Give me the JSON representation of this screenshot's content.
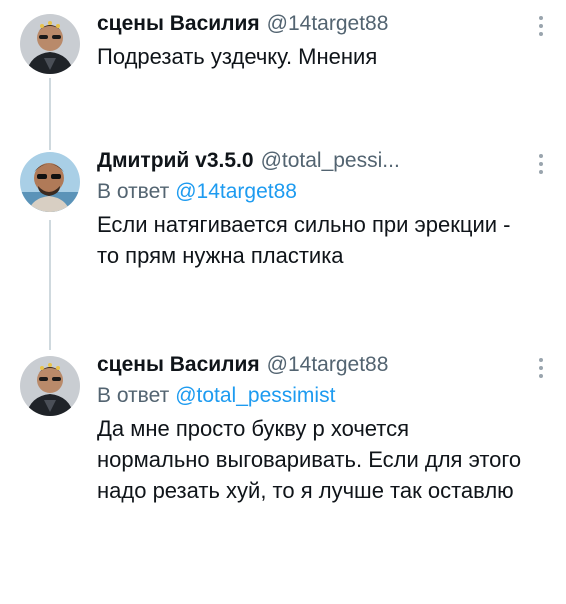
{
  "tweets": [
    {
      "name": "сцены Василия",
      "handle": "@14target88",
      "text": "Подрезать уздечку. Мнения"
    },
    {
      "name": "Дмитрий v3.5.0",
      "handle": "@total_pessi...",
      "reply_prefix": "В ответ",
      "reply_to": "@14target88",
      "text": "Если натягивается сильно при эрекции - то прям нужна пластика"
    },
    {
      "name": "сцены Василия",
      "handle": "@14target88",
      "reply_prefix": "В ответ",
      "reply_to": "@total_pessimist",
      "text": "Да мне просто букву р хочется нормально выговаривать. Если для этого надо резать хуй, то я лучше так оставлю"
    }
  ],
  "icons": {
    "more": "more-vertical-icon",
    "avatar": "user-avatar"
  }
}
